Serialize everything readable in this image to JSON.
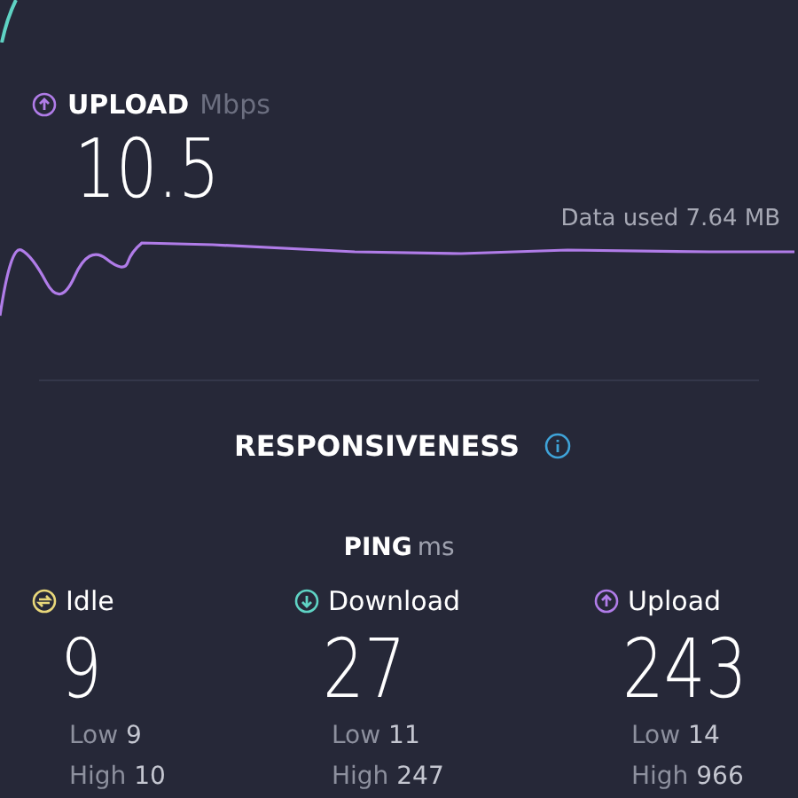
{
  "upload": {
    "title": "UPLOAD",
    "unit": "Mbps",
    "value": "10.5",
    "data_used": "Data used 7.64 MB"
  },
  "responsiveness": {
    "title": "RESPONSIVENESS"
  },
  "ping": {
    "title": "PING",
    "unit": "ms",
    "columns": [
      {
        "kind": "idle",
        "label": "Idle",
        "value": "9",
        "low_label": "Low",
        "low": "9",
        "high_label": "High",
        "high": "10"
      },
      {
        "kind": "download",
        "label": "Download",
        "value": "27",
        "low_label": "Low",
        "low": "11",
        "high_label": "High",
        "high": "247"
      },
      {
        "kind": "upload",
        "label": "Upload",
        "value": "243",
        "low_label": "Low",
        "low": "14",
        "high_label": "High",
        "high": "966"
      }
    ]
  }
}
